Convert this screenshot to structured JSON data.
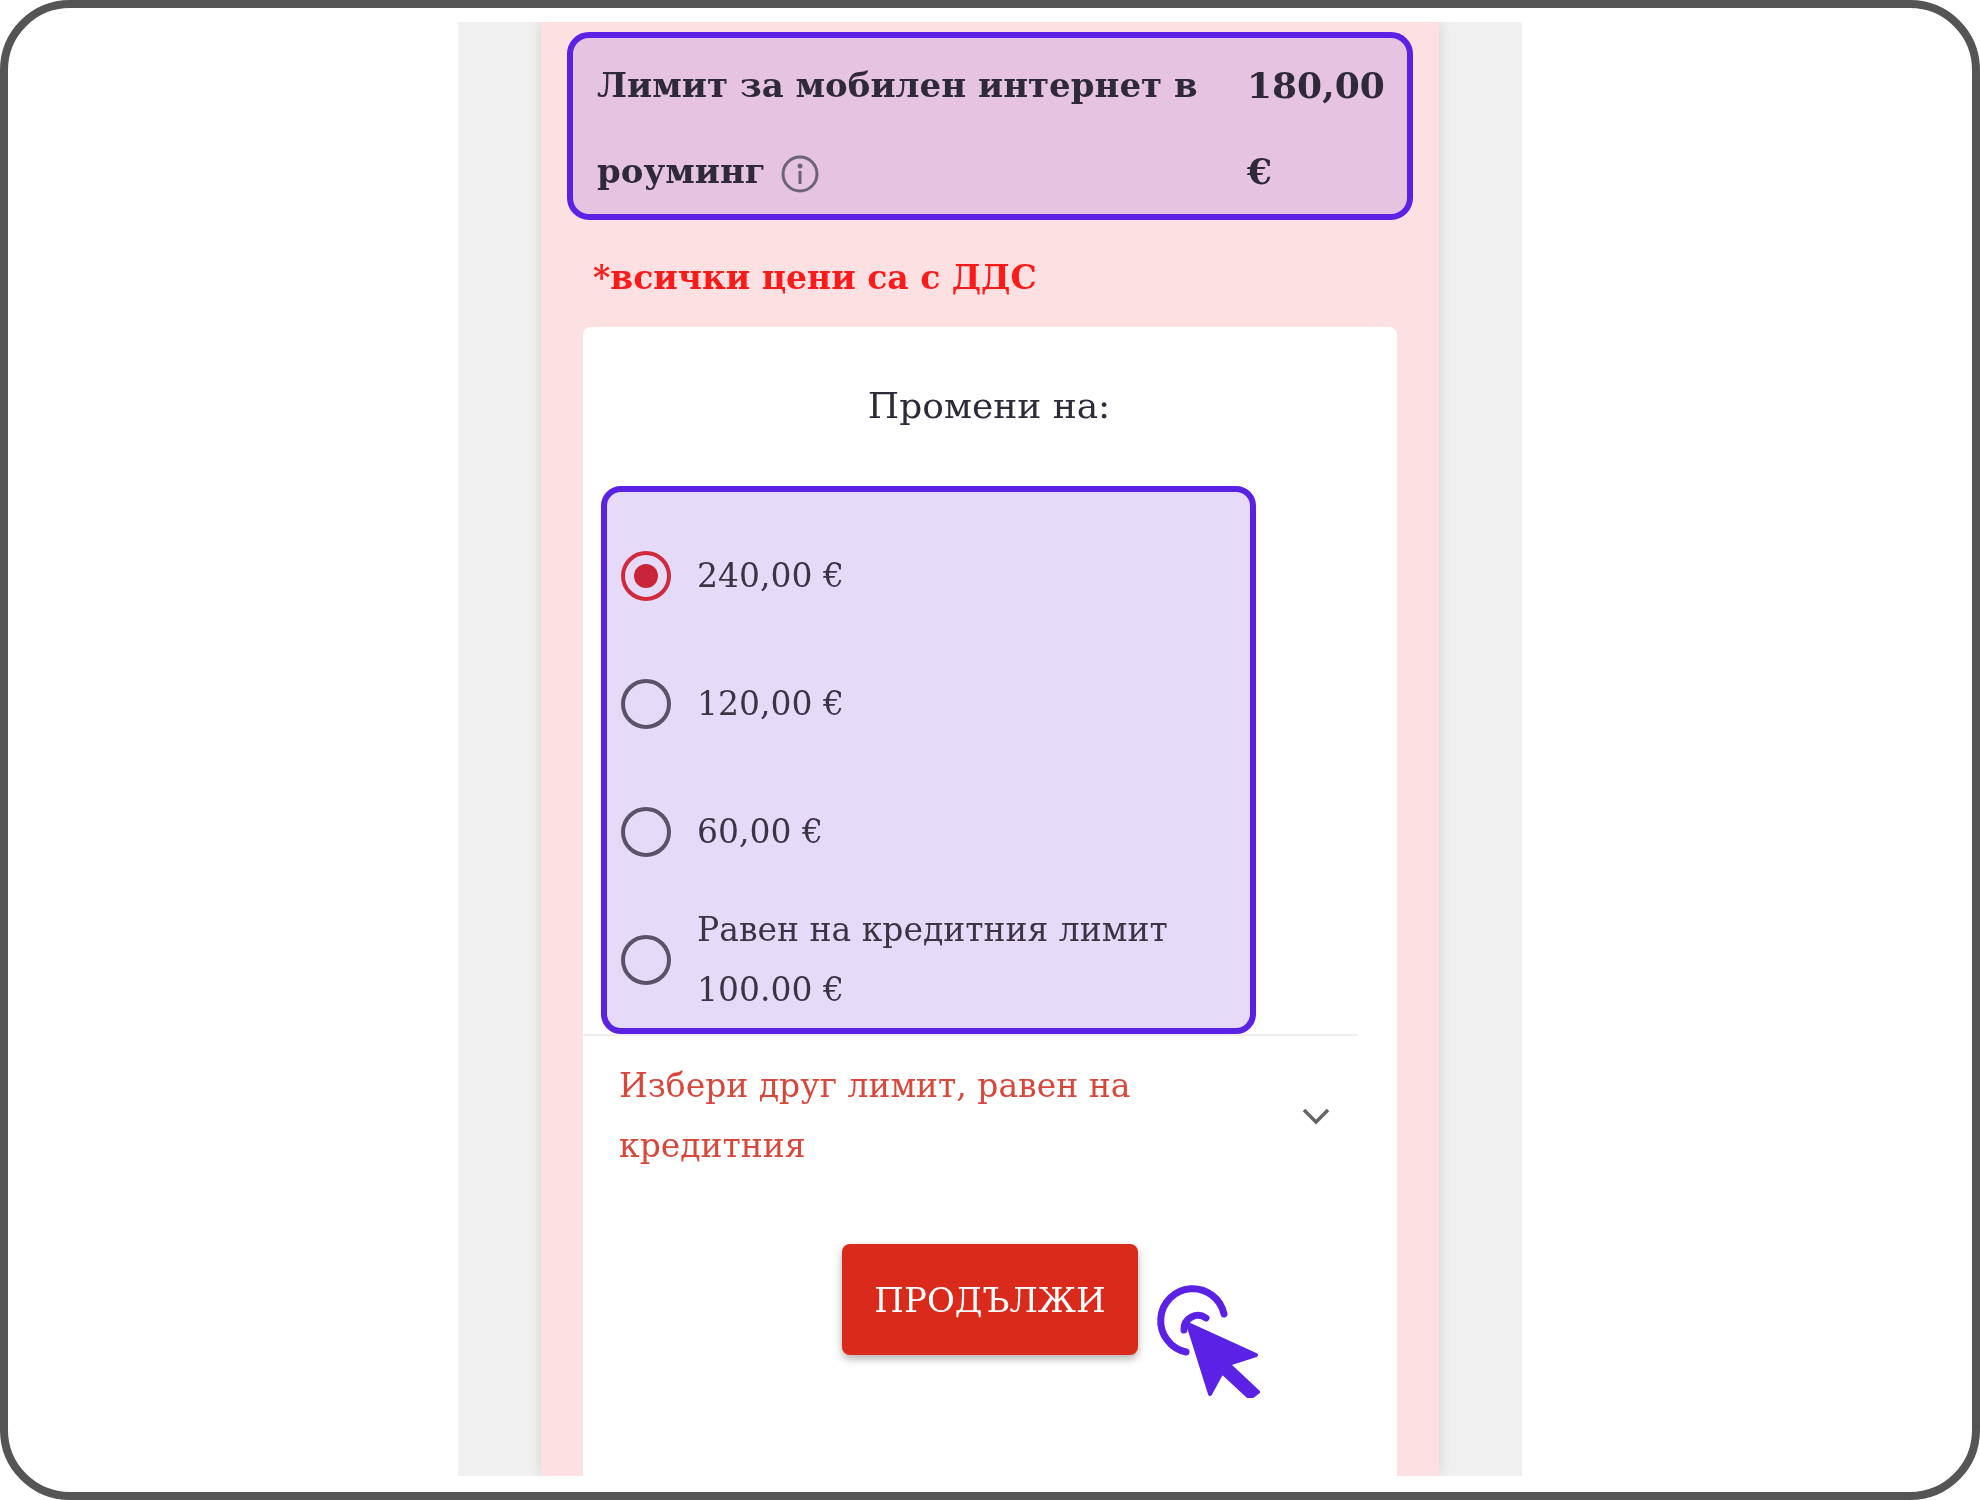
{
  "roaming_limit": {
    "label": "Лимит за мобилен интернет в роуминг",
    "value": "180,00 €"
  },
  "vat_note": "*всички цени са с ДДС",
  "change_to": {
    "title": "Промени на:",
    "options": [
      {
        "label": "240,00 €",
        "selected": true
      },
      {
        "label": "120,00 €",
        "selected": false
      },
      {
        "label": "60,00 €",
        "selected": false
      },
      {
        "label": "Равен на кредитния лимит 100.00 €",
        "selected": false
      }
    ]
  },
  "other_limit_select": {
    "value": "Избери друг лимит, равен на кредитния"
  },
  "continue_button": "ПРОДЪЛЖИ"
}
